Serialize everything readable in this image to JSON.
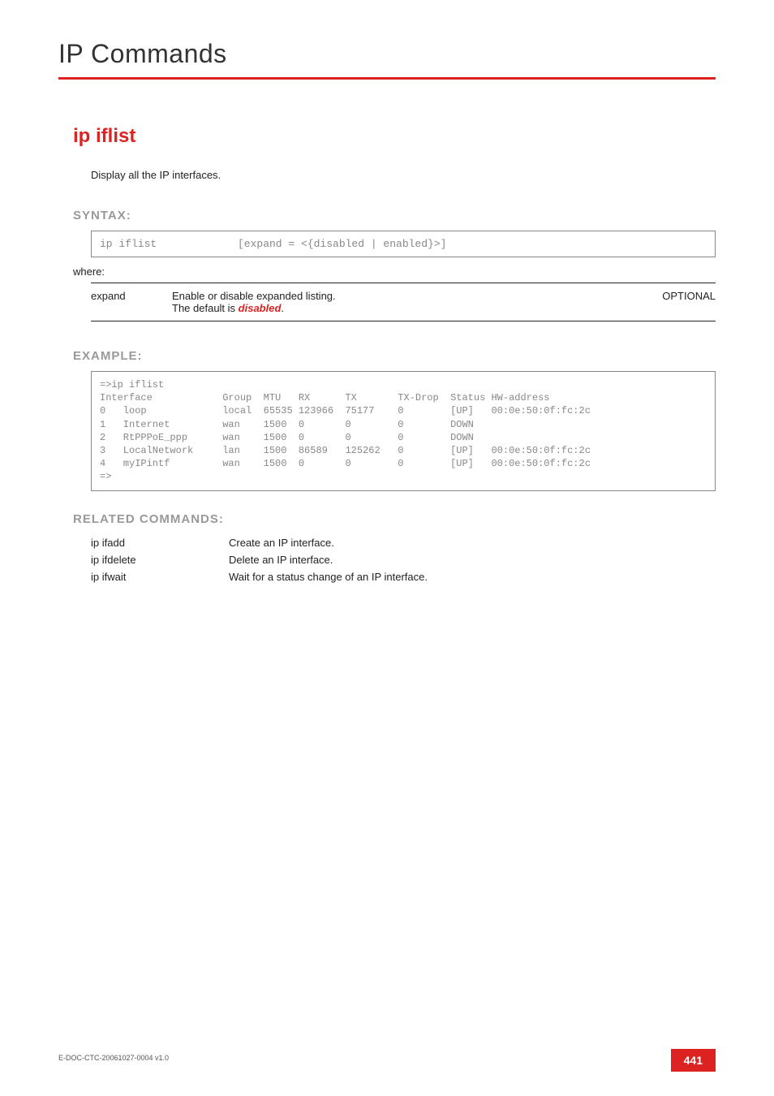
{
  "chapter": "IP Commands",
  "command": {
    "title": "ip iflist",
    "description": "Display all the IP interfaces."
  },
  "syntax": {
    "label": "SYNTAX:",
    "cmd": "ip iflist",
    "args": "[expand = <{disabled | enabled}>]",
    "where": "where:",
    "params": [
      {
        "name": "expand",
        "desc_pre": "Enable or disable expanded listing.\nThe default is ",
        "desc_em": "disabled",
        "desc_post": ".",
        "req": "OPTIONAL"
      }
    ]
  },
  "example": {
    "label": "EXAMPLE:",
    "text": "=>ip iflist\nInterface            Group  MTU   RX      TX       TX-Drop  Status HW-address\n0   loop             local  65535 123966  75177    0        [UP]   00:0e:50:0f:fc:2c\n1   Internet         wan    1500  0       0        0        DOWN\n2   RtPPPoE_ppp      wan    1500  0       0        0        DOWN\n3   LocalNetwork     lan    1500  86589   125262   0        [UP]   00:0e:50:0f:fc:2c\n4   myIPintf         wan    1500  0       0        0        [UP]   00:0e:50:0f:fc:2c\n=>"
  },
  "related": {
    "label": "RELATED COMMANDS:",
    "rows": [
      {
        "cmd": "ip ifadd",
        "desc": "Create an IP interface."
      },
      {
        "cmd": "ip ifdelete",
        "desc": "Delete an IP interface."
      },
      {
        "cmd": "ip ifwait",
        "desc": "Wait for a status change of an IP interface."
      }
    ]
  },
  "footer": {
    "doc": "E-DOC-CTC-20061027-0004 v1.0",
    "page": "441"
  }
}
